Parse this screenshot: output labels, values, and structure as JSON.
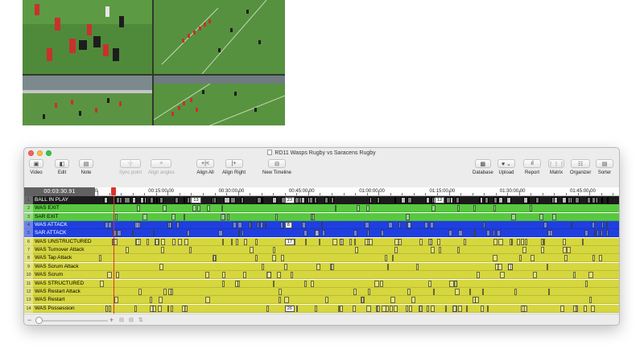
{
  "window": {
    "title": "RD11 Wasps Rugby vs Saracens Rugby"
  },
  "toolbar": {
    "left": [
      {
        "id": "video",
        "label": "Video",
        "icon": "video-icon",
        "glyph": "▣"
      },
      {
        "id": "edit",
        "label": "Edit",
        "icon": "edit-icon",
        "glyph": "◧"
      },
      {
        "id": "note",
        "label": "Note",
        "icon": "note-icon",
        "glyph": "▤"
      }
    ],
    "center": [
      {
        "id": "sync-point",
        "label": "Sync point",
        "icon": "sync-point-icon",
        "glyph": "-|-",
        "disabled": true
      },
      {
        "id": "align-angles",
        "label": "Align angles",
        "icon": "align-angles-icon",
        "glyph": "≡",
        "disabled": true
      },
      {
        "id": "align-all",
        "label": "Align All",
        "icon": "align-all-icon",
        "glyph": "+|<"
      },
      {
        "id": "align-right",
        "label": "Align Right",
        "icon": "align-right-icon",
        "glyph": "|+"
      },
      {
        "id": "new-timeline",
        "label": "New Timeline",
        "icon": "new-timeline-icon",
        "glyph": "⊟"
      }
    ],
    "right": [
      {
        "id": "database",
        "label": "Database",
        "icon": "database-icon",
        "glyph": "▩"
      },
      {
        "id": "upload",
        "label": "Upload",
        "icon": "upload-icon",
        "glyph": "♥ ⌄"
      },
      {
        "id": "report",
        "label": "Report",
        "icon": "report-icon",
        "glyph": "ıl"
      },
      {
        "id": "matrix",
        "label": "Matrix",
        "icon": "matrix-icon",
        "glyph": "⋮⋮⋮"
      },
      {
        "id": "organizer",
        "label": "Organizer",
        "icon": "organizer-icon",
        "glyph": "☷"
      },
      {
        "id": "sorter",
        "label": "Sorter",
        "icon": "sorter-icon",
        "glyph": "▤"
      }
    ]
  },
  "timeline": {
    "timecode": "00:03:30.91",
    "ruler_start_label": "0",
    "ticks": [
      {
        "label": "00:15:00.00",
        "minutes": 15
      },
      {
        "label": "00:30:00.00",
        "minutes": 30
      },
      {
        "label": "00:45:00.00",
        "minutes": 45
      },
      {
        "label": "01:00:00.00",
        "minutes": 60
      },
      {
        "label": "01:15:00.00",
        "minutes": 75
      },
      {
        "label": "01:30:00.00",
        "minutes": 90
      },
      {
        "label": "01:45:00.00",
        "minutes": 105
      }
    ],
    "playhead_minutes": 3.5,
    "rows": [
      {
        "n": "1",
        "name": "BALL IN PLAY",
        "color": "#1c1c1c",
        "text": "#ffffff",
        "labels": [
          {
            "m": 20,
            "t": "13"
          },
          {
            "m": 40,
            "t": "23"
          },
          {
            "m": 72,
            "t": "12"
          }
        ]
      },
      {
        "n": "2",
        "name": "WAS EXIT",
        "color": "#58c840",
        "text": "#000000",
        "labels": []
      },
      {
        "n": "3",
        "name": "SAR EXIT",
        "color": "#58c840",
        "text": "#000000",
        "labels": []
      },
      {
        "n": "4",
        "name": "WAS ATTACK",
        "color": "#1f3fe0",
        "text": "#ffffff",
        "labels": [
          {
            "m": 40,
            "t": "8"
          }
        ]
      },
      {
        "n": "5",
        "name": "SAR ATTACK",
        "color": "#1f3fe0",
        "text": "#ffffff",
        "labels": []
      },
      {
        "n": "6",
        "name": "WAS UNSTRUCTURED",
        "color": "#d6d63e",
        "text": "#000000",
        "labels": [
          {
            "m": 40,
            "t": "17"
          }
        ]
      },
      {
        "n": "7",
        "name": "WAS Turnover Attack",
        "color": "#d6d63e",
        "text": "#000000",
        "labels": []
      },
      {
        "n": "8",
        "name": "WAS Tap Attack",
        "color": "#d6d63e",
        "text": "#000000",
        "labels": []
      },
      {
        "n": "9",
        "name": "WAS Scrum Attack",
        "color": "#d6d63e",
        "text": "#000000",
        "labels": []
      },
      {
        "n": "10",
        "name": "WAS Scrum",
        "color": "#d6d63e",
        "text": "#000000",
        "labels": []
      },
      {
        "n": "11",
        "name": "WAS STRUCTURED",
        "color": "#d6d63e",
        "text": "#000000",
        "labels": []
      },
      {
        "n": "12",
        "name": "WAS Restart Attack",
        "color": "#d6d63e",
        "text": "#000000",
        "labels": []
      },
      {
        "n": "13",
        "name": "WAS Restart",
        "color": "#d6d63e",
        "text": "#000000",
        "labels": []
      },
      {
        "n": "14",
        "name": "WAS Possession",
        "color": "#d6d63e",
        "text": "#000000",
        "labels": [
          {
            "m": 40,
            "t": "26"
          }
        ]
      }
    ]
  },
  "statusbar": {
    "zoom_minus": "−",
    "zoom_plus": "+"
  }
}
